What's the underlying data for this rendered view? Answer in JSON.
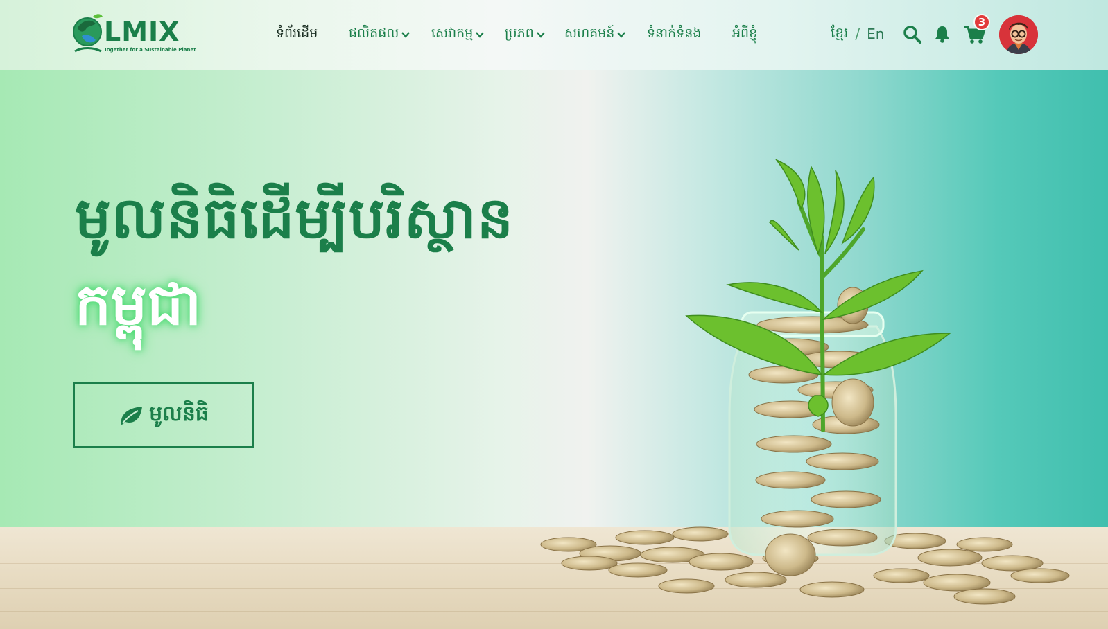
{
  "header": {
    "logo": {
      "text": "LMIX",
      "tagline": "Together for a Sustainable Planet"
    },
    "nav": [
      {
        "label": "ទំព័រដើម",
        "dropdown": false,
        "active": true
      },
      {
        "label": "ផលិតផល",
        "dropdown": true,
        "active": false
      },
      {
        "label": "សេវាកម្ម",
        "dropdown": true,
        "active": false
      },
      {
        "label": "ប្រភព",
        "dropdown": true,
        "active": false
      },
      {
        "label": "សហគមន៍",
        "dropdown": true,
        "active": false
      },
      {
        "label": "ទំនាក់ទំនង",
        "dropdown": false,
        "active": false
      },
      {
        "label": "អំពីខ្ញុំ",
        "dropdown": false,
        "active": false
      }
    ],
    "language": {
      "km": "ខ្មែរ",
      "separator": "/",
      "en": "En"
    },
    "cart_count": "3",
    "icons": [
      "search-icon",
      "bell-icon",
      "cart-icon",
      "avatar"
    ]
  },
  "hero": {
    "title_line1": "មូលនិធិដើម្បីបរិស្ថាន",
    "title_line2": "កម្ពុជា",
    "cta_label": "មូលនិធិ",
    "cta_icon": "leaf-icon"
  },
  "colors": {
    "brand_green": "#1b7f4a",
    "badge_red": "#e23b3b",
    "hero_left": "#a6e9b4",
    "hero_right": "#40bfae"
  }
}
